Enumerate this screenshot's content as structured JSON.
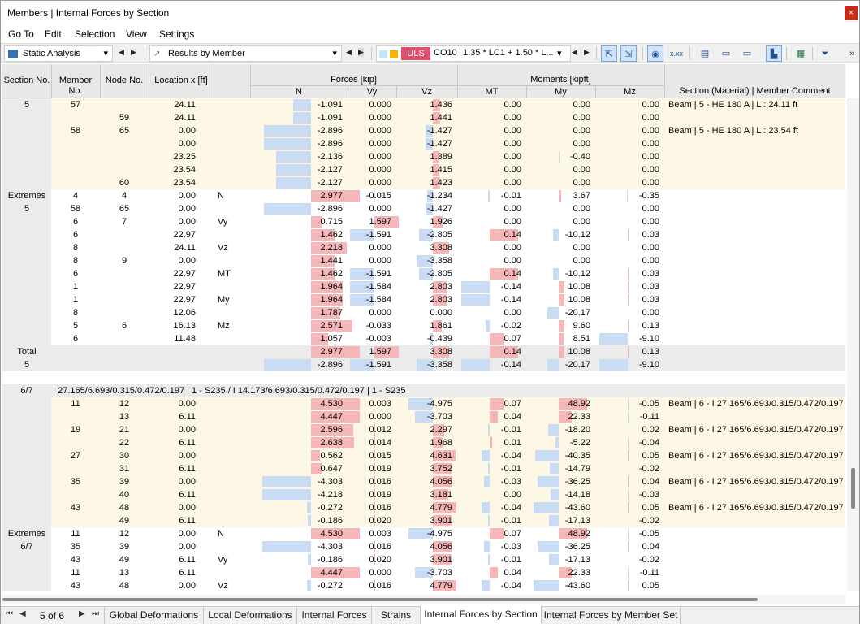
{
  "window": {
    "title": "Members | Internal Forces by Section",
    "close_label": "×"
  },
  "menu": [
    "Go To",
    "Edit",
    "Selection",
    "View",
    "Settings"
  ],
  "toolbar": {
    "analysis": "Static Analysis",
    "results": "Results by Member",
    "uls_label": "ULS",
    "combo_id": "CO10",
    "combo_expr": "1.35 * LC1 + 1.50 * L..."
  },
  "headers": {
    "section": "Section No.",
    "member": "Member No.",
    "node": "Node No.",
    "location": "Location x [ft]",
    "forces_group": "Forces [kip]",
    "moments_group": "Moments [kipft]",
    "n": "N",
    "vy": "Vy",
    "vz": "Vz",
    "mt": "MT",
    "my": "My",
    "mz": "Mz",
    "comment": "Section (Material) | Member Comment"
  },
  "rows": [
    {
      "sec": "5",
      "m": "57",
      "n": "",
      "x": "24.11",
      "tag": "",
      "N": "-1.091",
      "Vy": "0.000",
      "Vz": "1.436",
      "MT": "0.00",
      "My": "0.00",
      "Mz": "0.00",
      "cm": "Beam | 5 - HE 180 A | L : 24.11 ft",
      "bg": "y"
    },
    {
      "sec": "",
      "m": "",
      "n": "59",
      "x": "24.11",
      "tag": "",
      "N": "-1.091",
      "Vy": "0.000",
      "Vz": "1.441",
      "MT": "0.00",
      "My": "0.00",
      "Mz": "0.00",
      "cm": "",
      "bg": "y"
    },
    {
      "sec": "",
      "m": "58",
      "n": "65",
      "x": "0.00",
      "tag": "",
      "N": "-2.896",
      "Vy": "0.000",
      "Vz": "-1.427",
      "MT": "0.00",
      "My": "0.00",
      "Mz": "0.00",
      "cm": "Beam | 5 - HE 180 A | L : 23.54 ft",
      "bg": "y"
    },
    {
      "sec": "",
      "m": "",
      "n": "",
      "x": "0.00",
      "tag": "",
      "N": "-2.896",
      "Vy": "0.000",
      "Vz": "-1.427",
      "MT": "0.00",
      "My": "0.00",
      "Mz": "0.00",
      "cm": "",
      "bg": "y"
    },
    {
      "sec": "",
      "m": "",
      "n": "",
      "x": "23.25",
      "tag": "",
      "N": "-2.136",
      "Vy": "0.000",
      "Vz": "1.389",
      "MT": "0.00",
      "My": "-0.40",
      "Mz": "0.00",
      "cm": "",
      "bg": "y"
    },
    {
      "sec": "",
      "m": "",
      "n": "",
      "x": "23.54",
      "tag": "",
      "N": "-2.127",
      "Vy": "0.000",
      "Vz": "1.415",
      "MT": "0.00",
      "My": "0.00",
      "Mz": "0.00",
      "cm": "",
      "bg": "y"
    },
    {
      "sec": "",
      "m": "",
      "n": "60",
      "x": "23.54",
      "tag": "",
      "N": "-2.127",
      "Vy": "0.000",
      "Vz": "1.423",
      "MT": "0.00",
      "My": "0.00",
      "Mz": "0.00",
      "cm": "",
      "bg": "y"
    },
    {
      "sec": "Extremes",
      "m": "4",
      "n": "4",
      "x": "0.00",
      "tag": "N",
      "N": "2.977",
      "Vy": "-0.015",
      "Vz": "-1.234",
      "MT": "-0.01",
      "My": "3.67",
      "Mz": "-0.35",
      "cm": "",
      "bg": "w"
    },
    {
      "sec": "5",
      "m": "58",
      "n": "65",
      "x": "0.00",
      "tag": "",
      "N": "-2.896",
      "Vy": "0.000",
      "Vz": "-1.427",
      "MT": "0.00",
      "My": "0.00",
      "Mz": "0.00",
      "cm": "",
      "bg": "w"
    },
    {
      "sec": "",
      "m": "6",
      "n": "7",
      "x": "0.00",
      "tag": "Vy",
      "N": "0.715",
      "Vy": "1.597",
      "Vz": "1.926",
      "MT": "0.00",
      "My": "0.00",
      "Mz": "0.00",
      "cm": "",
      "bg": "w"
    },
    {
      "sec": "",
      "m": "6",
      "n": "",
      "x": "22.97",
      "tag": "",
      "N": "1.462",
      "Vy": "-1.591",
      "Vz": "-2.805",
      "MT": "0.14",
      "My": "-10.12",
      "Mz": "0.03",
      "cm": "",
      "bg": "w"
    },
    {
      "sec": "",
      "m": "8",
      "n": "",
      "x": "24.11",
      "tag": "Vz",
      "N": "2.218",
      "Vy": "0.000",
      "Vz": "3.308",
      "MT": "0.00",
      "My": "0.00",
      "Mz": "0.00",
      "cm": "",
      "bg": "w"
    },
    {
      "sec": "",
      "m": "8",
      "n": "9",
      "x": "0.00",
      "tag": "",
      "N": "1.441",
      "Vy": "0.000",
      "Vz": "-3.358",
      "MT": "0.00",
      "My": "0.00",
      "Mz": "0.00",
      "cm": "",
      "bg": "w"
    },
    {
      "sec": "",
      "m": "6",
      "n": "",
      "x": "22.97",
      "tag": "MT",
      "N": "1.462",
      "Vy": "-1.591",
      "Vz": "-2.805",
      "MT": "0.14",
      "My": "-10.12",
      "Mz": "0.03",
      "cm": "",
      "bg": "w"
    },
    {
      "sec": "",
      "m": "1",
      "n": "",
      "x": "22.97",
      "tag": "",
      "N": "1.964",
      "Vy": "-1.584",
      "Vz": "2.803",
      "MT": "-0.14",
      "My": "10.08",
      "Mz": "0.03",
      "cm": "",
      "bg": "w"
    },
    {
      "sec": "",
      "m": "1",
      "n": "",
      "x": "22.97",
      "tag": "My",
      "N": "1.964",
      "Vy": "-1.584",
      "Vz": "2.803",
      "MT": "-0.14",
      "My": "10.08",
      "Mz": "0.03",
      "cm": "",
      "bg": "w"
    },
    {
      "sec": "",
      "m": "8",
      "n": "",
      "x": "12.06",
      "tag": "",
      "N": "1.787",
      "Vy": "0.000",
      "Vz": "0.000",
      "MT": "0.00",
      "My": "-20.17",
      "Mz": "0.00",
      "cm": "",
      "bg": "w"
    },
    {
      "sec": "",
      "m": "5",
      "n": "6",
      "x": "16.13",
      "tag": "Mz",
      "N": "2.571",
      "Vy": "-0.033",
      "Vz": "1.861",
      "MT": "-0.02",
      "My": "9.60",
      "Mz": "0.13",
      "cm": "",
      "bg": "w"
    },
    {
      "sec": "",
      "m": "6",
      "n": "",
      "x": "11.48",
      "tag": "",
      "N": "1.057",
      "Vy": "-0.003",
      "Vz": "-0.439",
      "MT": "0.07",
      "My": "8.51",
      "Mz": "-9.10",
      "cm": "",
      "bg": "w"
    },
    {
      "sec": "Total",
      "m": "",
      "n": "",
      "x": "",
      "tag": "",
      "N": "2.977",
      "Vy": "1.597",
      "Vz": "3.308",
      "MT": "0.14",
      "My": "10.08",
      "Mz": "0.13",
      "cm": "",
      "bg": "g"
    },
    {
      "sec": "5",
      "m": "",
      "n": "",
      "x": "",
      "tag": "",
      "N": "-2.896",
      "Vy": "-1.591",
      "Vz": "-3.358",
      "MT": "-0.14",
      "My": "-20.17",
      "Mz": "-9.10",
      "cm": "",
      "bg": "g"
    }
  ],
  "section2_title": "I 27.165/6.693/0.315/0.472/0.197 | 1 - S235 / I 14.173/6.693/0.315/0.472/0.197 | 1 - S235",
  "section2_id": "6/7",
  "rows2": [
    {
      "sec": "",
      "m": "11",
      "n": "12",
      "x": "0.00",
      "tag": "",
      "N": "4.530",
      "Vy": "0.003",
      "Vz": "-4.975",
      "MT": "0.07",
      "My": "48.92",
      "Mz": "-0.05",
      "cm": "Beam | 6 - I 27.165/6.693/0.315/0.472/0.197",
      "bg": "y"
    },
    {
      "sec": "",
      "m": "",
      "n": "13",
      "x": "6.11",
      "tag": "",
      "N": "4.447",
      "Vy": "0.000",
      "Vz": "-3.703",
      "MT": "0.04",
      "My": "22.33",
      "Mz": "-0.11",
      "cm": "",
      "bg": "y"
    },
    {
      "sec": "",
      "m": "19",
      "n": "21",
      "x": "0.00",
      "tag": "",
      "N": "2.596",
      "Vy": "0.012",
      "Vz": "2.297",
      "MT": "-0.01",
      "My": "-18.20",
      "Mz": "0.02",
      "cm": "Beam | 6 - I 27.165/6.693/0.315/0.472/0.197",
      "bg": "y"
    },
    {
      "sec": "",
      "m": "",
      "n": "22",
      "x": "6.11",
      "tag": "",
      "N": "2.638",
      "Vy": "0.014",
      "Vz": "1.968",
      "MT": "0.01",
      "My": "-5.22",
      "Mz": "-0.04",
      "cm": "",
      "bg": "y"
    },
    {
      "sec": "",
      "m": "27",
      "n": "30",
      "x": "0.00",
      "tag": "",
      "N": "0.562",
      "Vy": "0.015",
      "Vz": "4.631",
      "MT": "-0.04",
      "My": "-40.35",
      "Mz": "0.05",
      "cm": "Beam | 6 - I 27.165/6.693/0.315/0.472/0.197",
      "bg": "y"
    },
    {
      "sec": "",
      "m": "",
      "n": "31",
      "x": "6.11",
      "tag": "",
      "N": "0.647",
      "Vy": "0.019",
      "Vz": "3.752",
      "MT": "-0.01",
      "My": "-14.79",
      "Mz": "-0.02",
      "cm": "",
      "bg": "y"
    },
    {
      "sec": "",
      "m": "35",
      "n": "39",
      "x": "0.00",
      "tag": "",
      "N": "-4.303",
      "Vy": "0.016",
      "Vz": "4.056",
      "MT": "-0.03",
      "My": "-36.25",
      "Mz": "0.04",
      "cm": "Beam | 6 - I 27.165/6.693/0.315/0.472/0.197",
      "bg": "y"
    },
    {
      "sec": "",
      "m": "",
      "n": "40",
      "x": "6.11",
      "tag": "",
      "N": "-4.218",
      "Vy": "0.019",
      "Vz": "3.181",
      "MT": "0.00",
      "My": "-14.18",
      "Mz": "-0.03",
      "cm": "",
      "bg": "y"
    },
    {
      "sec": "",
      "m": "43",
      "n": "48",
      "x": "0.00",
      "tag": "",
      "N": "-0.272",
      "Vy": "0.016",
      "Vz": "4.779",
      "MT": "-0.04",
      "My": "-43.60",
      "Mz": "0.05",
      "cm": "Beam | 6 - I 27.165/6.693/0.315/0.472/0.197",
      "bg": "y"
    },
    {
      "sec": "",
      "m": "",
      "n": "49",
      "x": "6.11",
      "tag": "",
      "N": "-0.186",
      "Vy": "0.020",
      "Vz": "3.901",
      "MT": "-0.01",
      "My": "-17.13",
      "Mz": "-0.02",
      "cm": "",
      "bg": "y"
    },
    {
      "sec": "Extremes",
      "m": "11",
      "n": "12",
      "x": "0.00",
      "tag": "N",
      "N": "4.530",
      "Vy": "0.003",
      "Vz": "-4.975",
      "MT": "0.07",
      "My": "48.92",
      "Mz": "-0.05",
      "cm": "",
      "bg": "w"
    },
    {
      "sec": "6/7",
      "m": "35",
      "n": "39",
      "x": "0.00",
      "tag": "",
      "N": "-4.303",
      "Vy": "0.016",
      "Vz": "4.056",
      "MT": "-0.03",
      "My": "-36.25",
      "Mz": "0.04",
      "cm": "",
      "bg": "w"
    },
    {
      "sec": "",
      "m": "43",
      "n": "49",
      "x": "6.11",
      "tag": "Vy",
      "N": "-0.186",
      "Vy": "0.020",
      "Vz": "3.901",
      "MT": "-0.01",
      "My": "-17.13",
      "Mz": "-0.02",
      "cm": "",
      "bg": "w"
    },
    {
      "sec": "",
      "m": "11",
      "n": "13",
      "x": "6.11",
      "tag": "",
      "N": "4.447",
      "Vy": "0.000",
      "Vz": "-3.703",
      "MT": "0.04",
      "My": "22.33",
      "Mz": "-0.11",
      "cm": "",
      "bg": "w"
    },
    {
      "sec": "",
      "m": "43",
      "n": "48",
      "x": "0.00",
      "tag": "Vz",
      "N": "-0.272",
      "Vy": "0.016",
      "Vz": "4.779",
      "MT": "-0.04",
      "My": "-43.60",
      "Mz": "0.05",
      "cm": "",
      "bg": "w"
    }
  ],
  "tabs": [
    "Global Deformations",
    "Local Deformations",
    "Internal Forces",
    "Strains",
    "Internal Forces by Section",
    "Internal Forces by Member Set"
  ],
  "active_tab": "Internal Forces by Section",
  "page_indicator": "5 of 6",
  "colors": {
    "pos_bar": "#f4b6b6",
    "neg_bar": "#c9dcf3",
    "uls": "#e0506c",
    "max_marker": "#c0202a",
    "min_marker": "#2f4fc0"
  }
}
